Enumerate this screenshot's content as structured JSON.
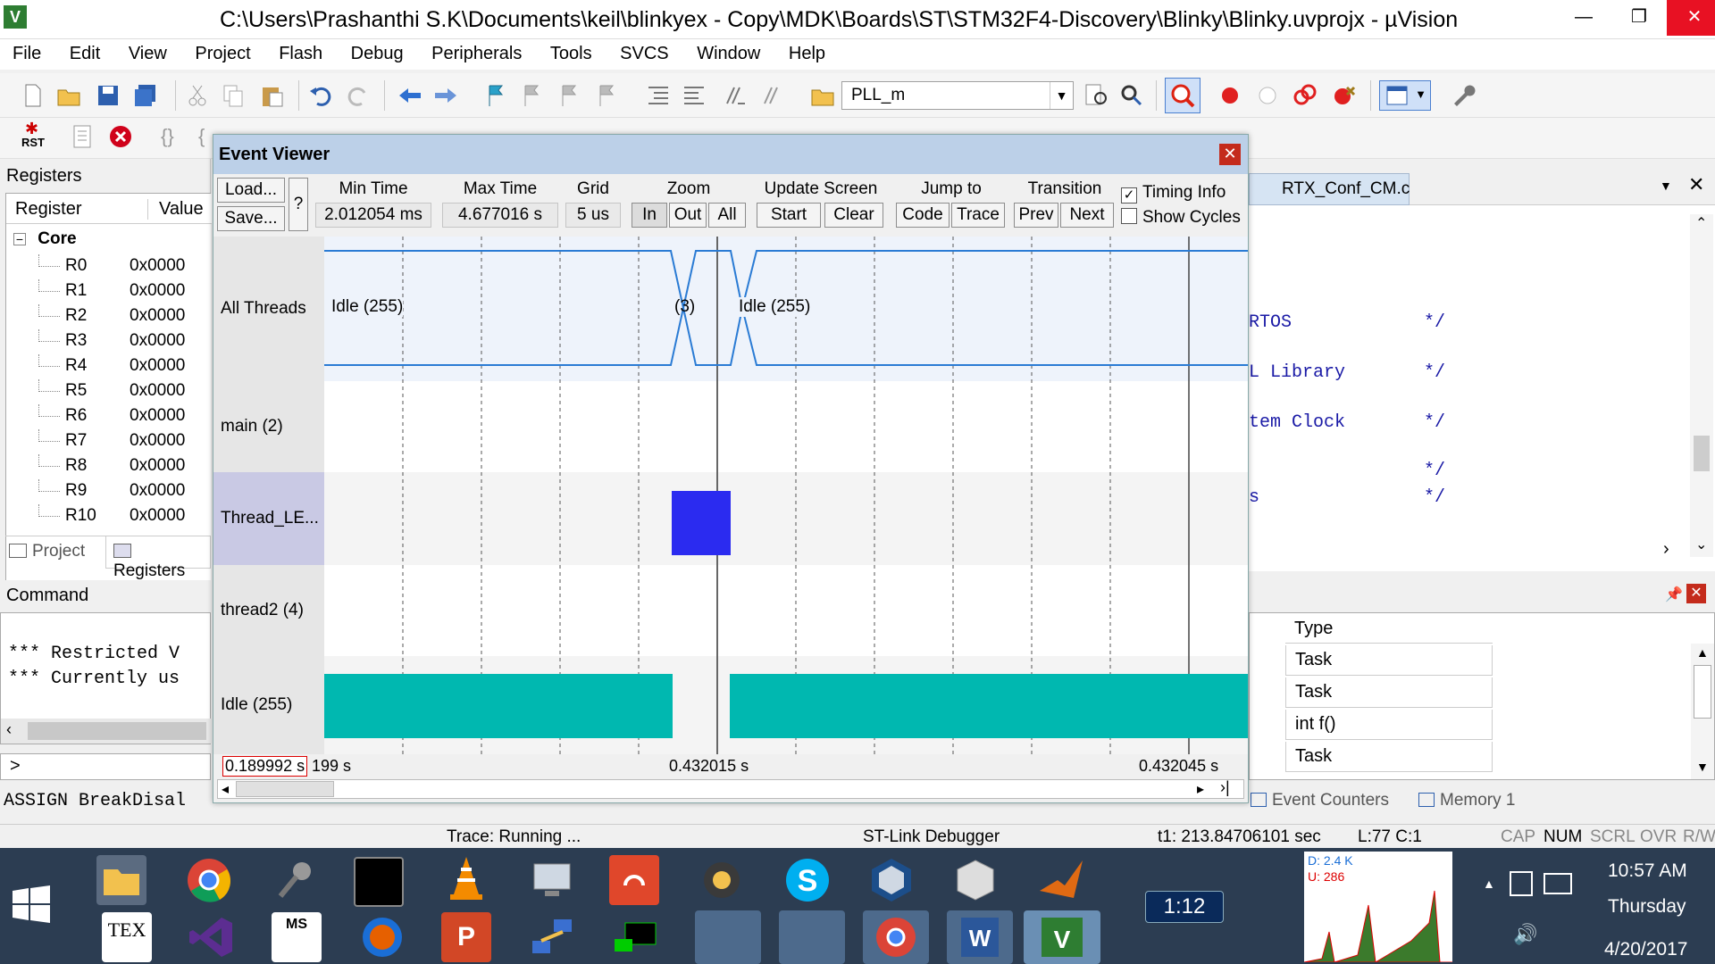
{
  "window": {
    "title": "C:\\Users\\Prashanthi S.K\\Documents\\keil\\blinkyex - Copy\\MDK\\Boards\\ST\\STM32F4-Discovery\\Blinky\\Blinky.uvprojx - µVision",
    "app_icon": "V",
    "minimize": "—",
    "maximize": "❐",
    "close": "✕"
  },
  "menu": [
    "File",
    "Edit",
    "View",
    "Project",
    "Flash",
    "Debug",
    "Peripherals",
    "Tools",
    "SVCS",
    "Window",
    "Help"
  ],
  "toolbar": {
    "target_combo": "PLL_m",
    "rst_label": "RST"
  },
  "registers_panel": {
    "title": "Registers",
    "col_register": "Register",
    "col_value": "Value",
    "group": "Core",
    "rows": [
      {
        "name": "R0",
        "value": "0x0000"
      },
      {
        "name": "R1",
        "value": "0x0000"
      },
      {
        "name": "R2",
        "value": "0x0000"
      },
      {
        "name": "R3",
        "value": "0x0000"
      },
      {
        "name": "R4",
        "value": "0x0000"
      },
      {
        "name": "R5",
        "value": "0x0000"
      },
      {
        "name": "R6",
        "value": "0x0000"
      },
      {
        "name": "R7",
        "value": "0x0000"
      },
      {
        "name": "R8",
        "value": "0x0000"
      },
      {
        "name": "R9",
        "value": "0x0000"
      },
      {
        "name": "R10",
        "value": "0x0000"
      }
    ],
    "tab_project": "Project",
    "tab_registers": "Registers"
  },
  "command_panel": {
    "title": "Command",
    "lines": [
      "*** Restricted V",
      "*** Currently us"
    ],
    "prompt": ">",
    "assign_line": "ASSIGN BreakDisal"
  },
  "event_viewer": {
    "title": "Event Viewer",
    "close": "✕",
    "load": "Load...",
    "save": "Save...",
    "help": "?",
    "min_time_label": "Min Time",
    "min_time_value": "2.012054 ms",
    "max_time_label": "Max Time",
    "max_time_value": "4.677016 s",
    "grid_label": "Grid",
    "grid_value": "5 us",
    "zoom_label": "Zoom",
    "zoom_in": "In",
    "zoom_out": "Out",
    "zoom_all": "All",
    "update_label": "Update Screen",
    "update_start": "Start",
    "update_clear": "Clear",
    "jump_label": "Jump to",
    "jump_code": "Code",
    "jump_trace": "Trace",
    "transition_label": "Transition",
    "transition_prev": "Prev",
    "transition_next": "Next",
    "timing_info": "Timing Info",
    "timing_info_checked": true,
    "show_cycles": "Show Cycles",
    "show_cycles_checked": false,
    "rows": [
      "All Threads",
      "main (2)",
      "Thread_LE...",
      "thread2 (4)",
      "Idle (255)"
    ],
    "all_threads_left": "Idle (255)",
    "all_threads_mid": "(3)",
    "all_threads_right": "Idle (255)",
    "cursor_time": "0.189992 s",
    "cursor_time_suffix": "199 s",
    "center_time": "0.432015 s",
    "right_time": "0.432045 s",
    "colors": {
      "thread_block": "#2b2bf0",
      "idle_block": "#00b8b0",
      "signal_line": "#2a7bd4"
    }
  },
  "editor": {
    "tab": "RTX_Conf_CM.c",
    "lines": [
      {
        "text": "RTOS",
        "comment": "*/"
      },
      {
        "text": "L Library",
        "comment": "*/"
      },
      {
        "text": "tem Clock",
        "comment": "*/"
      },
      {
        "text": "",
        "comment": "*/"
      },
      {
        "text": "s",
        "comment": "*/"
      }
    ]
  },
  "watch_panel": {
    "col_type": "Type",
    "rows": [
      "Task",
      "Task",
      "int f()",
      "Task"
    ],
    "tab_event_counters": "Event Counters",
    "tab_memory": "Memory 1"
  },
  "status_bar": {
    "trace": "Trace: Running ...",
    "debugger": "ST-Link Debugger",
    "time": "t1: 213.84706101 sec",
    "cursor": "L:77 C:1",
    "cap": "CAP",
    "num": "NUM",
    "scrl": "SCRL",
    "ovr": "OVR",
    "rw": "R/W"
  },
  "taskbar": {
    "timer": "1:12",
    "meter_d": "D: 2.4 K",
    "meter_u": "U: 286",
    "clock_time": "10:57 AM",
    "clock_day": "Thursday",
    "clock_date": "4/20/2017",
    "tex_label": "TEX",
    "ms_label": "MS"
  }
}
